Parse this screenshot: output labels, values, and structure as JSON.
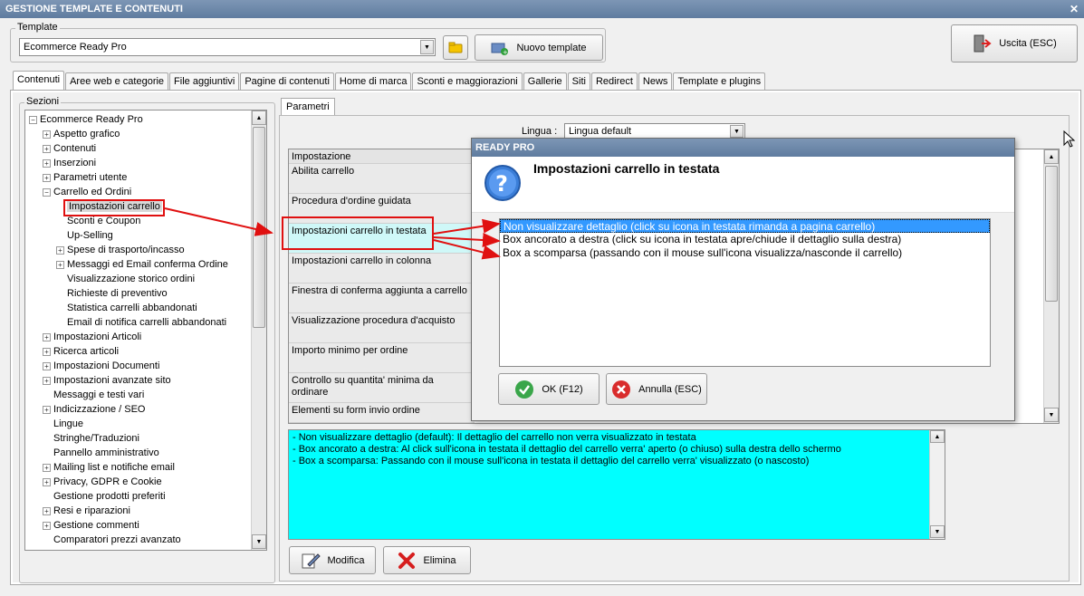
{
  "window": {
    "title": "GESTIONE TEMPLATE E CONTENUTI",
    "close": "✕"
  },
  "template": {
    "group_label": "Template",
    "selected": "Ecommerce Ready Pro",
    "new_label": "Nuovo template"
  },
  "exit_label": "Uscita (ESC)",
  "tabs": [
    "Contenuti",
    "Aree web e categorie",
    "File aggiuntivi",
    "Pagine di contenuti",
    "Home di marca",
    "Sconti e maggiorazioni",
    "Gallerie",
    "Siti",
    "Redirect",
    "News",
    "Template e plugins"
  ],
  "sections": {
    "label": "Sezioni",
    "items": [
      {
        "label": "Ecommerce Ready Pro",
        "level": 0,
        "expander": "−"
      },
      {
        "label": "Aspetto grafico",
        "level": 1,
        "expander": "+"
      },
      {
        "label": "Contenuti",
        "level": 1,
        "expander": "+"
      },
      {
        "label": "Inserzioni",
        "level": 1,
        "expander": "+"
      },
      {
        "label": "Parametri utente",
        "level": 1,
        "expander": "+"
      },
      {
        "label": "Carrello ed Ordini",
        "level": 1,
        "expander": "−"
      },
      {
        "label": "Impostazioni carrello",
        "level": 2,
        "expander": ""
      },
      {
        "label": "Sconti e Coupon",
        "level": 2,
        "expander": ""
      },
      {
        "label": "Up-Selling",
        "level": 2,
        "expander": ""
      },
      {
        "label": "Spese di trasporto/incasso",
        "level": 2,
        "expander": "+"
      },
      {
        "label": "Messaggi ed Email conferma Ordine",
        "level": 2,
        "expander": "+"
      },
      {
        "label": "Visualizzazione storico ordini",
        "level": 2,
        "expander": ""
      },
      {
        "label": "Richieste di preventivo",
        "level": 2,
        "expander": ""
      },
      {
        "label": "Statistica carrelli abbandonati",
        "level": 2,
        "expander": ""
      },
      {
        "label": "Email di notifica carrelli abbandonati",
        "level": 2,
        "expander": ""
      },
      {
        "label": "Impostazioni Articoli",
        "level": 1,
        "expander": "+"
      },
      {
        "label": "Ricerca articoli",
        "level": 1,
        "expander": "+"
      },
      {
        "label": "Impostazioni Documenti",
        "level": 1,
        "expander": "+"
      },
      {
        "label": "Impostazioni avanzate sito",
        "level": 1,
        "expander": "+"
      },
      {
        "label": "Messaggi e testi vari",
        "level": 1,
        "expander": ""
      },
      {
        "label": "Indicizzazione / SEO",
        "level": 1,
        "expander": "+"
      },
      {
        "label": "Lingue",
        "level": 1,
        "expander": ""
      },
      {
        "label": "Stringhe/Traduzioni",
        "level": 1,
        "expander": ""
      },
      {
        "label": "Pannello amministrativo",
        "level": 1,
        "expander": ""
      },
      {
        "label": "Mailing list e notifiche email",
        "level": 1,
        "expander": "+"
      },
      {
        "label": "Privacy, GDPR e Cookie",
        "level": 1,
        "expander": "+"
      },
      {
        "label": "Gestione prodotti preferiti",
        "level": 1,
        "expander": ""
      },
      {
        "label": "Resi e riparazioni",
        "level": 1,
        "expander": "+"
      },
      {
        "label": "Gestione commenti",
        "level": 1,
        "expander": "+"
      },
      {
        "label": "Comparatori prezzi avanzato",
        "level": 1,
        "expander": ""
      }
    ]
  },
  "params": {
    "tab": "Parametri",
    "language_label": "Lingua :",
    "language_value": "Lingua default",
    "column_header": "Impostazione",
    "rows": [
      "Abilita carrello",
      "Procedura d'ordine guidata",
      "Impostazioni carrello in testata",
      "Impostazioni carrello in colonna",
      "Finestra di conferma aggiunta a carrello",
      "Visualizzazione procedura d'acquisto",
      "Importo minimo per ordine",
      "Controllo su quantita' minima da ordinare",
      "Elementi su form invio ordine"
    ]
  },
  "info": {
    "lines": [
      "- Non visualizzare dettaglio (default): Il dettaglio del carrello non verra visualizzato in testata",
      "- Box ancorato a destra: Al click sull'icona in testata il dettaglio del carrello verra' aperto (o chiuso) sulla destra dello schermo",
      "- Box a scomparsa: Passando con il mouse sull'icona in testata il dettaglio del carrello verra' visualizzato (o nascosto)"
    ]
  },
  "buttons": {
    "modify": "Modifica",
    "delete": "Elimina"
  },
  "dialog": {
    "title": "READY PRO",
    "heading": "Impostazioni carrello in testata",
    "options": [
      "Non visualizzare dettaglio (click su icona in testata rimanda a pagina carrello)",
      "Box ancorato a destra (click su icona in testata apre/chiude il dettaglio sulla destra)",
      "Box a scomparsa (passando con il mouse sull'icona visualizza/nasconde il carrello)"
    ],
    "ok": "OK (F12)",
    "cancel": "Annulla (ESC)"
  },
  "colors": {
    "accent_red": "#e01010",
    "info_bg": "#00ffff",
    "selection": "#3399ff"
  }
}
